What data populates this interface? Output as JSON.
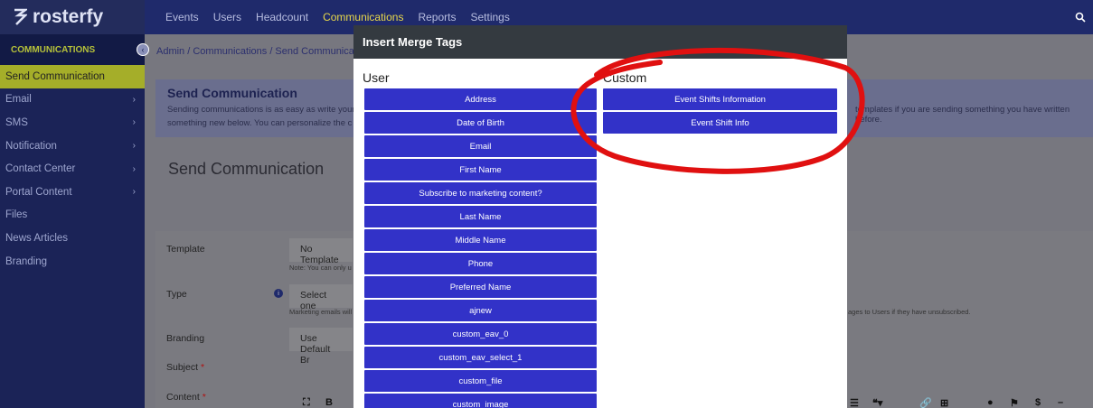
{
  "app": {
    "logo_text": "rosterfy"
  },
  "topnav": {
    "links": [
      "Events",
      "Users",
      "Headcount",
      "Communications",
      "Reports",
      "Settings"
    ],
    "active_index": 3
  },
  "sidebar": {
    "section": "COMMUNICATIONS",
    "items": [
      {
        "label": "Send Communication",
        "active": true,
        "chevron": false
      },
      {
        "label": "Email",
        "chevron": true
      },
      {
        "label": "SMS",
        "chevron": true
      },
      {
        "label": "Notification",
        "chevron": true
      },
      {
        "label": "Contact Center",
        "chevron": true
      },
      {
        "label": "Portal Content",
        "chevron": true
      },
      {
        "label": "Files",
        "chevron": false
      },
      {
        "label": "News Articles",
        "chevron": false
      },
      {
        "label": "Branding",
        "chevron": false
      }
    ]
  },
  "breadcrumb": {
    "text": "Admin / Communications / Send Communication"
  },
  "info": {
    "title": "Send Communication",
    "line1": "Sending communications is as easy as write your",
    "line2": "something new below. You can personalize the c",
    "right": "templates if you are sending something you have written before."
  },
  "card": {
    "title": "Send Communication"
  },
  "form": {
    "template_label": "Template",
    "template_value": "No Template",
    "template_note": "Note: You can only u",
    "type_label": "Type",
    "type_value": "Select one",
    "type_note": "Marketing emails will",
    "type_note_right": "ages to Users if they have unsubscribed.",
    "branding_label": "Branding",
    "branding_value": "Use Default Br",
    "subject_label": "Subject",
    "content_label": "Content",
    "required_mark": "*"
  },
  "modal": {
    "title": "Insert Merge Tags",
    "user_heading": "User",
    "custom_heading": "Custom",
    "user_tags": [
      "Address",
      "Date of Birth",
      "Email",
      "First Name",
      "Subscribe to marketing content?",
      "Last Name",
      "Middle Name",
      "Phone",
      "Preferred Name",
      "ajnew",
      "custom_eav_0",
      "custom_eav_select_1",
      "custom_file",
      "custom_image"
    ],
    "custom_tags": [
      "Event Shifts Information",
      "Event Shift Info"
    ]
  },
  "colors": {
    "nav": "#1f2a6b",
    "sidebar_active": "#a5ae29",
    "tag_button": "#3232c8",
    "annotation": "#e01010"
  },
  "icons": {
    "logo": "rosterfy-logo-icon",
    "search": "search-icon",
    "collapse": "chevron-left-icon",
    "info": "info-icon"
  }
}
